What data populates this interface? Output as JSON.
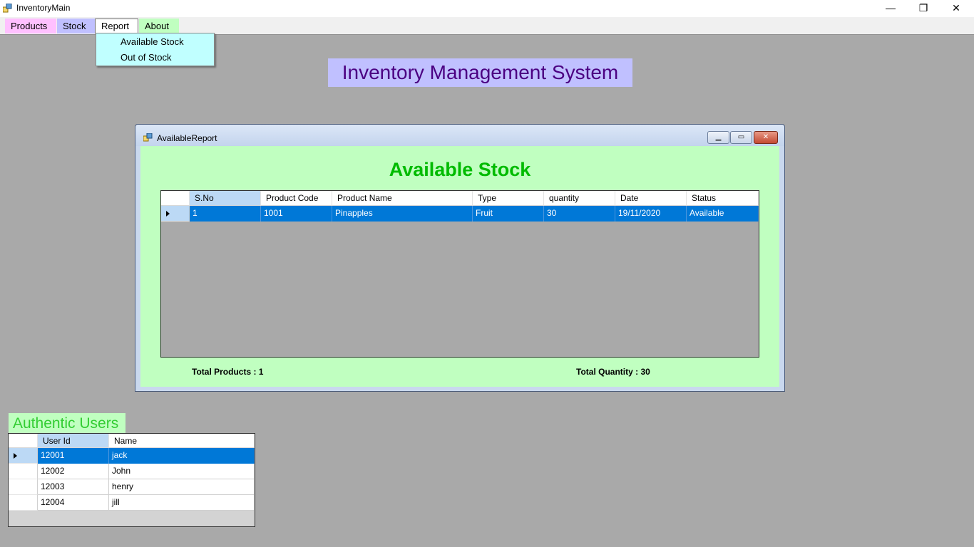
{
  "window": {
    "title": "InventoryMain",
    "controls": {
      "minimize": "—",
      "restore": "❐",
      "close": "✕"
    }
  },
  "menu": {
    "items": [
      "Products",
      "Stock",
      "Report",
      "About"
    ],
    "colors": {
      "products": "#ffc0ff",
      "stock": "#c0c0ff",
      "about": "#c0ffc0"
    },
    "report_dropdown": [
      "Available Stock",
      "Out of Stock"
    ]
  },
  "main_title": "Inventory Management System",
  "child_window": {
    "title": "AvailableReport",
    "controls": {
      "minimize": "▁",
      "maximize": "▭",
      "close": "✕"
    },
    "heading": "Available Stock",
    "grid": {
      "columns": [
        "S.No",
        "Product Code",
        "Product Name",
        "Type",
        "quantity",
        "Date",
        "Status"
      ],
      "rows": [
        [
          "1",
          "1001",
          "Pinapples",
          "Fruit",
          "30",
          "19/11/2020",
          "Available"
        ]
      ]
    },
    "total_products": "Total Products : 1",
    "total_quantity": "Total Quantity : 30"
  },
  "users": {
    "label": "Authentic Users",
    "columns": [
      "User Id",
      "Name"
    ],
    "rows": [
      [
        "12001",
        "jack"
      ],
      [
        "12002",
        "John"
      ],
      [
        "12003",
        "henry"
      ],
      [
        "12004",
        "jill"
      ]
    ]
  }
}
